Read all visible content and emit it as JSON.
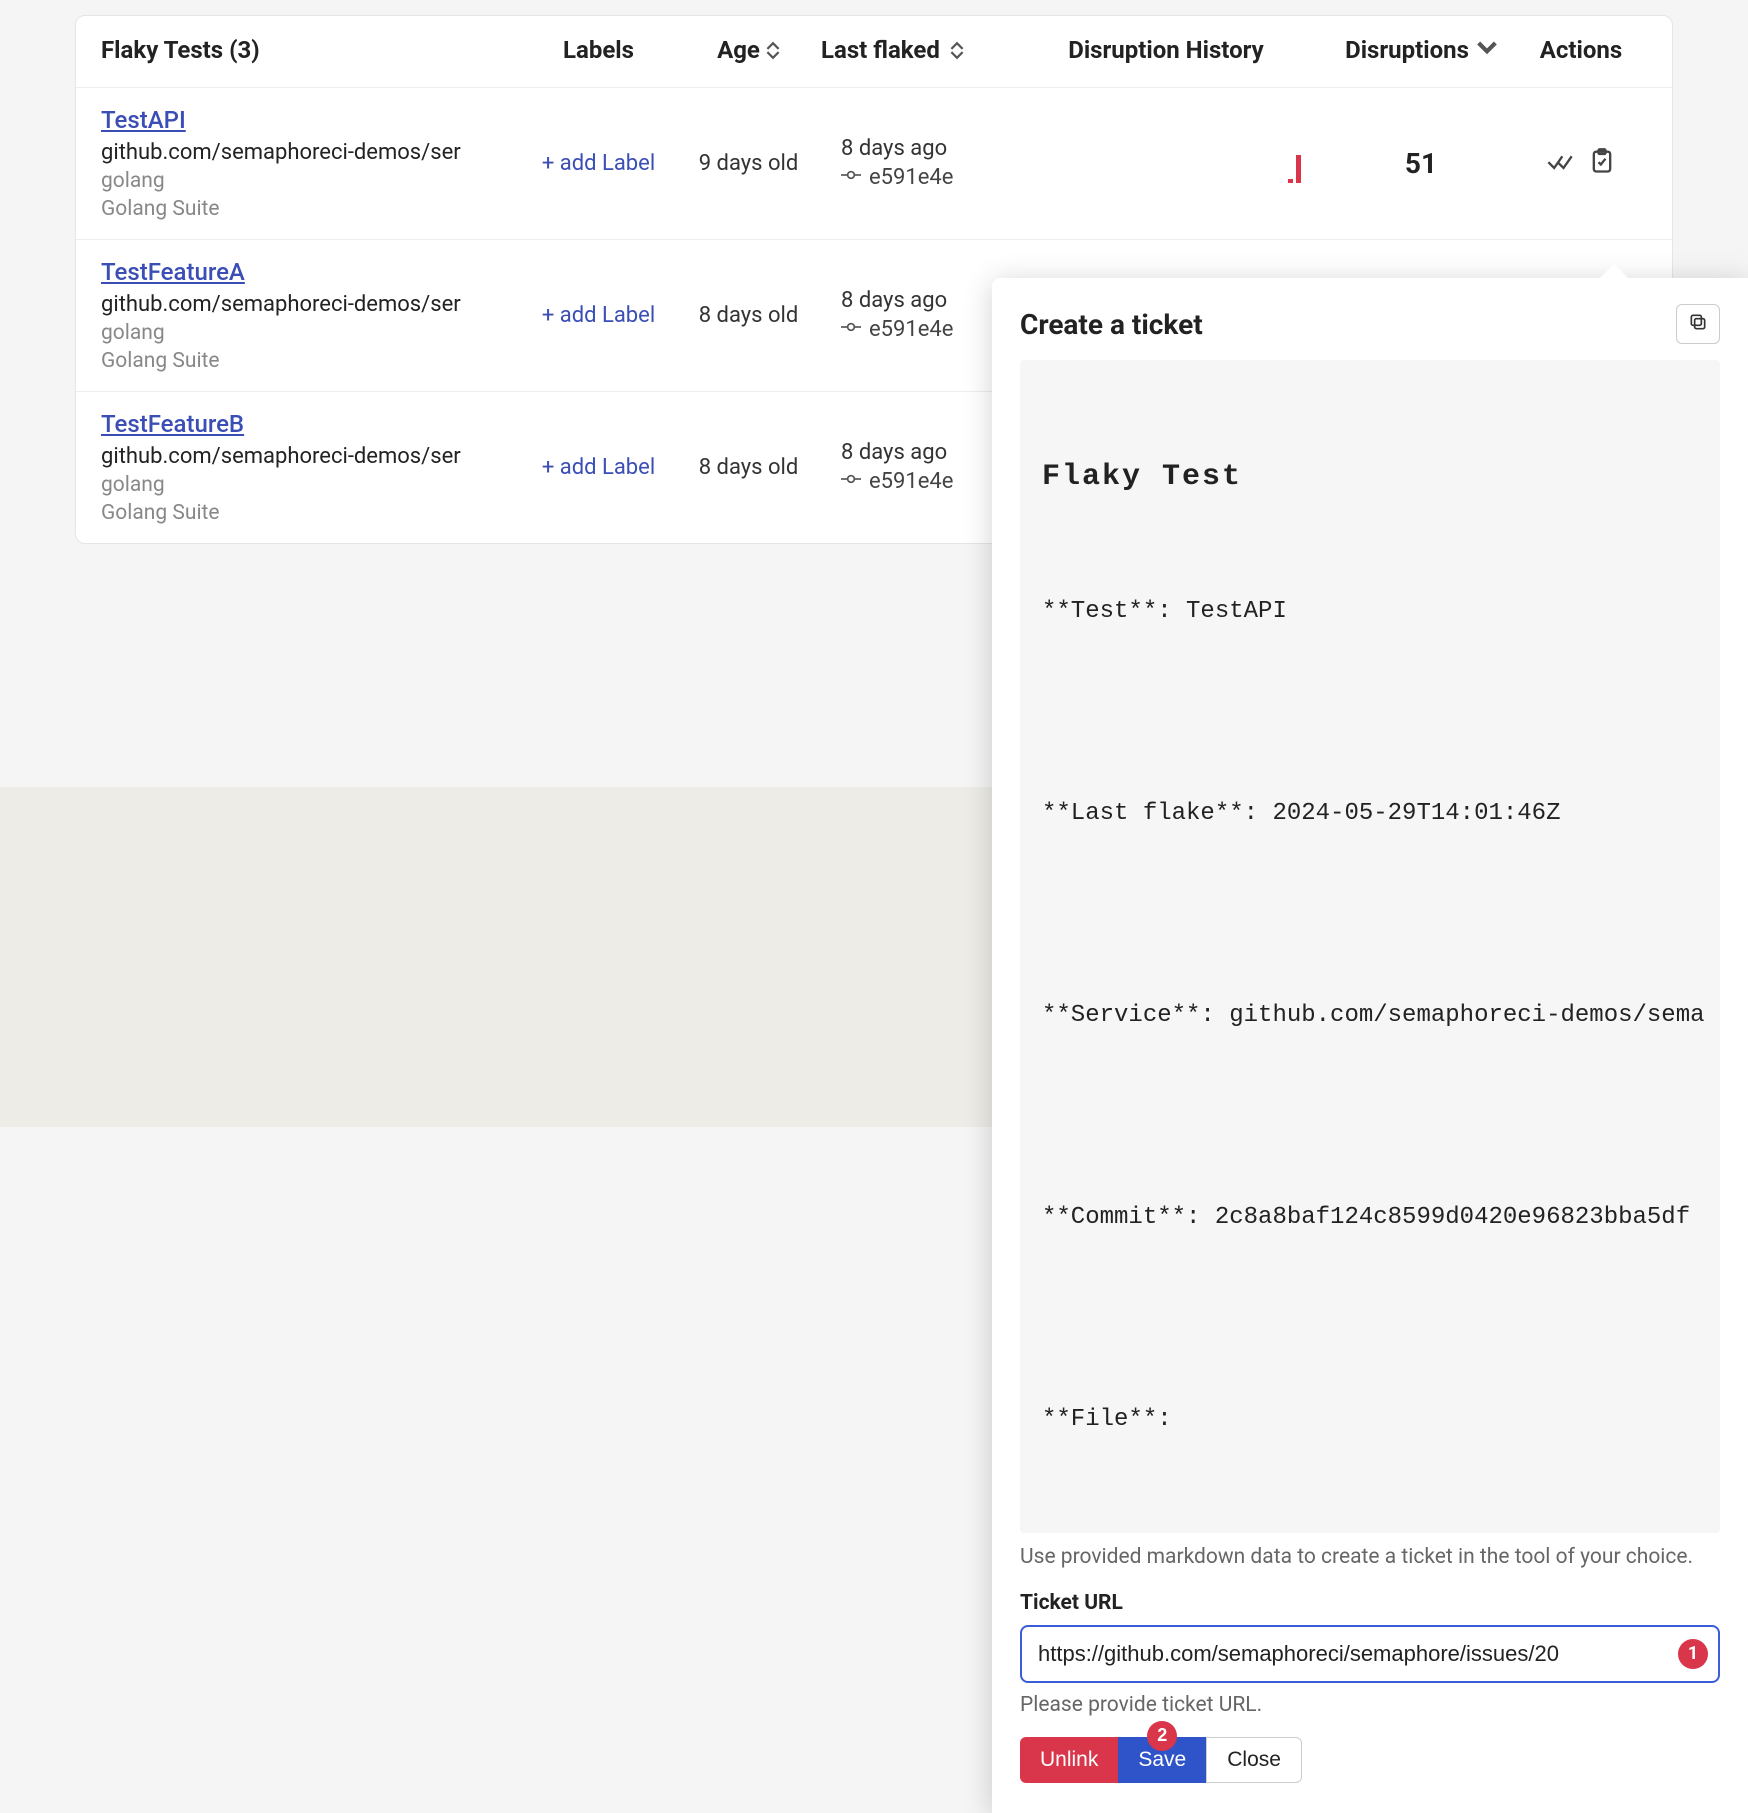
{
  "table": {
    "title": "Flaky Tests (3)",
    "columns": {
      "labels": "Labels",
      "age": "Age",
      "last_flaked": "Last flaked",
      "history": "Disruption History",
      "disruptions": "Disruptions",
      "actions": "Actions"
    },
    "add_label_text": "+ add Label",
    "rows": [
      {
        "name": "TestAPI",
        "path": "github.com/semaphoreci-demos/ser",
        "lang": "golang",
        "suite": "Golang Suite",
        "age": "9 days old",
        "last_age": "8 days ago",
        "commit": "e591e4e",
        "disruptions": "51",
        "bars": [
          4,
          28
        ]
      },
      {
        "name": "TestFeatureA",
        "path": "github.com/semaphoreci-demos/ser",
        "lang": "golang",
        "suite": "Golang Suite",
        "age": "8 days old",
        "last_age": "8 days ago",
        "commit": "e591e4e",
        "disruptions": "",
        "bars": []
      },
      {
        "name": "TestFeatureB",
        "path": "github.com/semaphoreci-demos/ser",
        "lang": "golang",
        "suite": "Golang Suite",
        "age": "8 days old",
        "last_age": "8 days ago",
        "commit": "e591e4e",
        "disruptions": "",
        "bars": []
      }
    ]
  },
  "popover": {
    "title": "Create a ticket",
    "md_title": "Flaky Test",
    "md_lines": {
      "test": "**Test**: TestAPI",
      "last_flake": "**Last flake**: 2024-05-29T14:01:46Z",
      "service": "**Service**: github.com/semaphoreci-demos/sema",
      "commit": "**Commit**: 2c8a8baf124c8599d0420e96823bba5df",
      "file": "**File**:"
    },
    "help": "Use provided markdown data to create a ticket in the tool of your choice.",
    "url_label": "Ticket URL",
    "url_value": "https://github.com/semaphoreci/semaphore/issues/20",
    "hint": "Please provide ticket URL.",
    "buttons": {
      "unlink": "Unlink",
      "save": "Save",
      "close": "Close"
    },
    "badges": {
      "url": "1",
      "save": "2"
    }
  }
}
